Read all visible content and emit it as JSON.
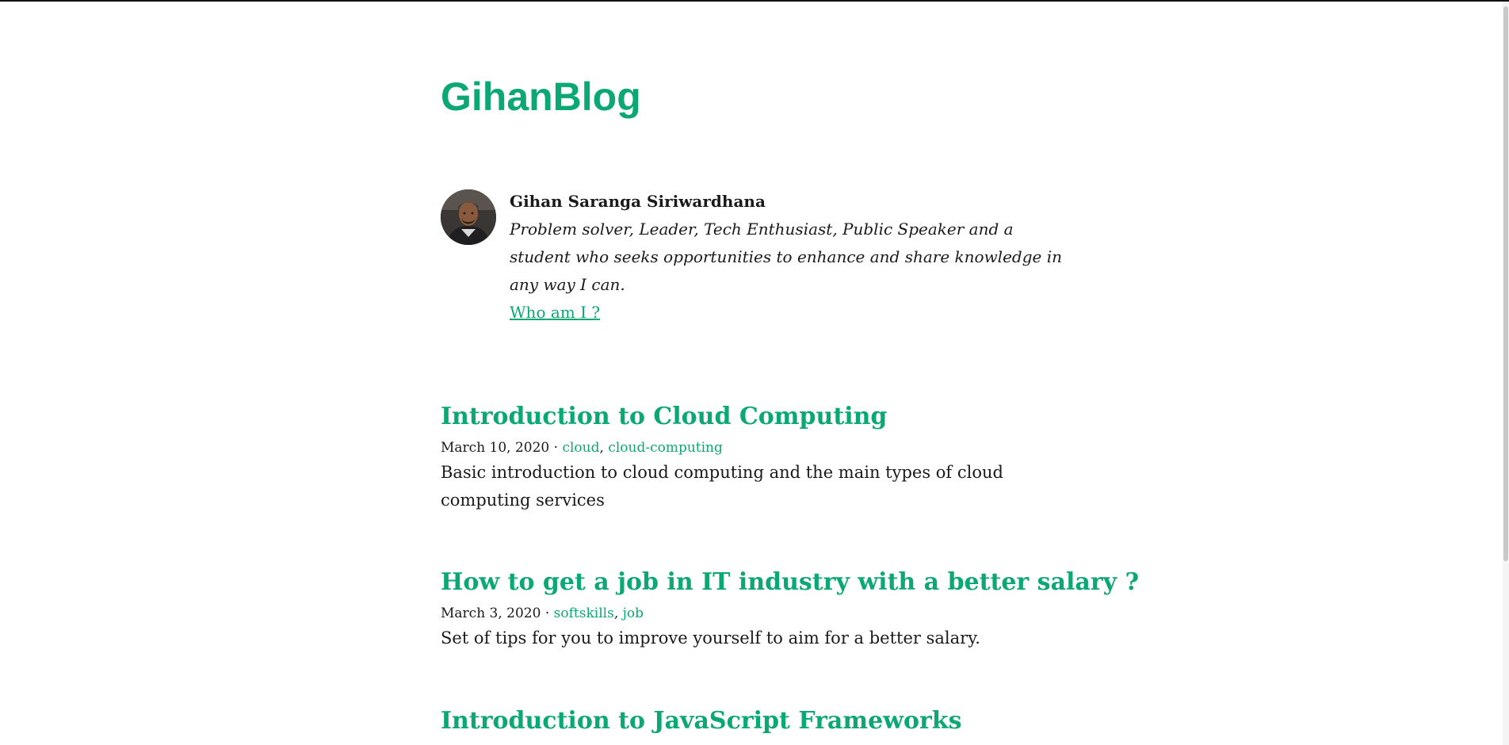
{
  "site": {
    "title": "GihanBlog",
    "accent_color": "#0ba774"
  },
  "bio": {
    "avatar_icon": "avatar-photo",
    "name": "Gihan Saranga Siriwardhana",
    "description": "Problem solver, Leader, Tech Enthusiast, Public Speaker and a student who seeks opportunities to enhance and share knowledge in any way I can.",
    "link_label": "Who am I ?"
  },
  "posts": [
    {
      "title": "Introduction to Cloud Computing",
      "date": "March 10, 2020",
      "separator": " · ",
      "tags": [
        "cloud",
        "cloud-computing"
      ],
      "excerpt": "Basic introduction to cloud computing and the main types of cloud computing services"
    },
    {
      "title": "How to get a job in IT industry with a better salary ?",
      "date": "March 3, 2020",
      "separator": " · ",
      "tags": [
        "softskills",
        "job"
      ],
      "excerpt": "Set of tips for you to improve yourself to aim for a better salary."
    },
    {
      "title": "Introduction to JavaScript Frameworks"
    }
  ]
}
